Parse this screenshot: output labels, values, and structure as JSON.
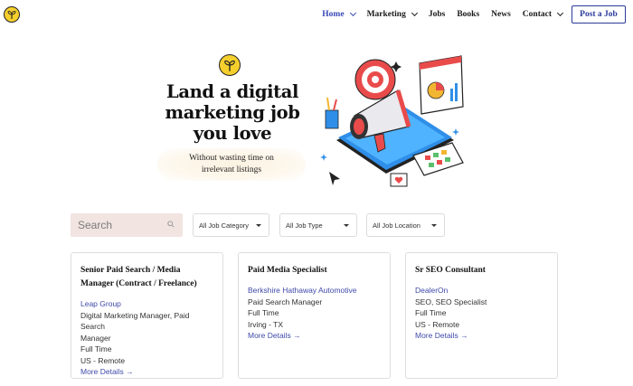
{
  "nav": {
    "items": [
      {
        "label": "Home",
        "has_dropdown": true,
        "active": true
      },
      {
        "label": "Marketing",
        "has_dropdown": true,
        "active": false
      },
      {
        "label": "Jobs",
        "has_dropdown": false,
        "active": false
      },
      {
        "label": "Books",
        "has_dropdown": false,
        "active": false
      },
      {
        "label": "News",
        "has_dropdown": false,
        "active": false
      },
      {
        "label": "Contact",
        "has_dropdown": true,
        "active": false
      }
    ],
    "post_button": "Post a Job",
    "accent_color": "#3849b5"
  },
  "hero": {
    "title_lines": [
      "Land a digital",
      "marketing job",
      "you love"
    ],
    "subtitle_lines": [
      "Without wasting time on",
      "irrelevant listings"
    ],
    "illustration": "megaphone-phone-marketing-illustration"
  },
  "filters": {
    "search_placeholder": "Search",
    "category": "All Job Category",
    "type": "All Job Type",
    "location": "All Job Location"
  },
  "jobs": [
    {
      "title_lines": [
        "Senior Paid Search / Media",
        "Manager (Contract / Freelance)"
      ],
      "company": "Leap Group",
      "category_lines": [
        "Digital Marketing Manager, Paid Search",
        "Manager"
      ],
      "type": "Full Time",
      "location": "US - Remote",
      "more": "More Details →"
    },
    {
      "title_lines": [
        "Paid Media Specialist"
      ],
      "company": "Berkshire Hathaway Automotive",
      "category_lines": [
        "Paid Search Manager"
      ],
      "type": "Full Time",
      "location": "Irving - TX",
      "more": "More Details →"
    },
    {
      "title_lines": [
        "Sr SEO Consultant"
      ],
      "company": "DealerOn",
      "category_lines": [
        "SEO, SEO Specialist"
      ],
      "type": "Full Time",
      "location": "US - Remote",
      "more": "More Details →"
    }
  ]
}
